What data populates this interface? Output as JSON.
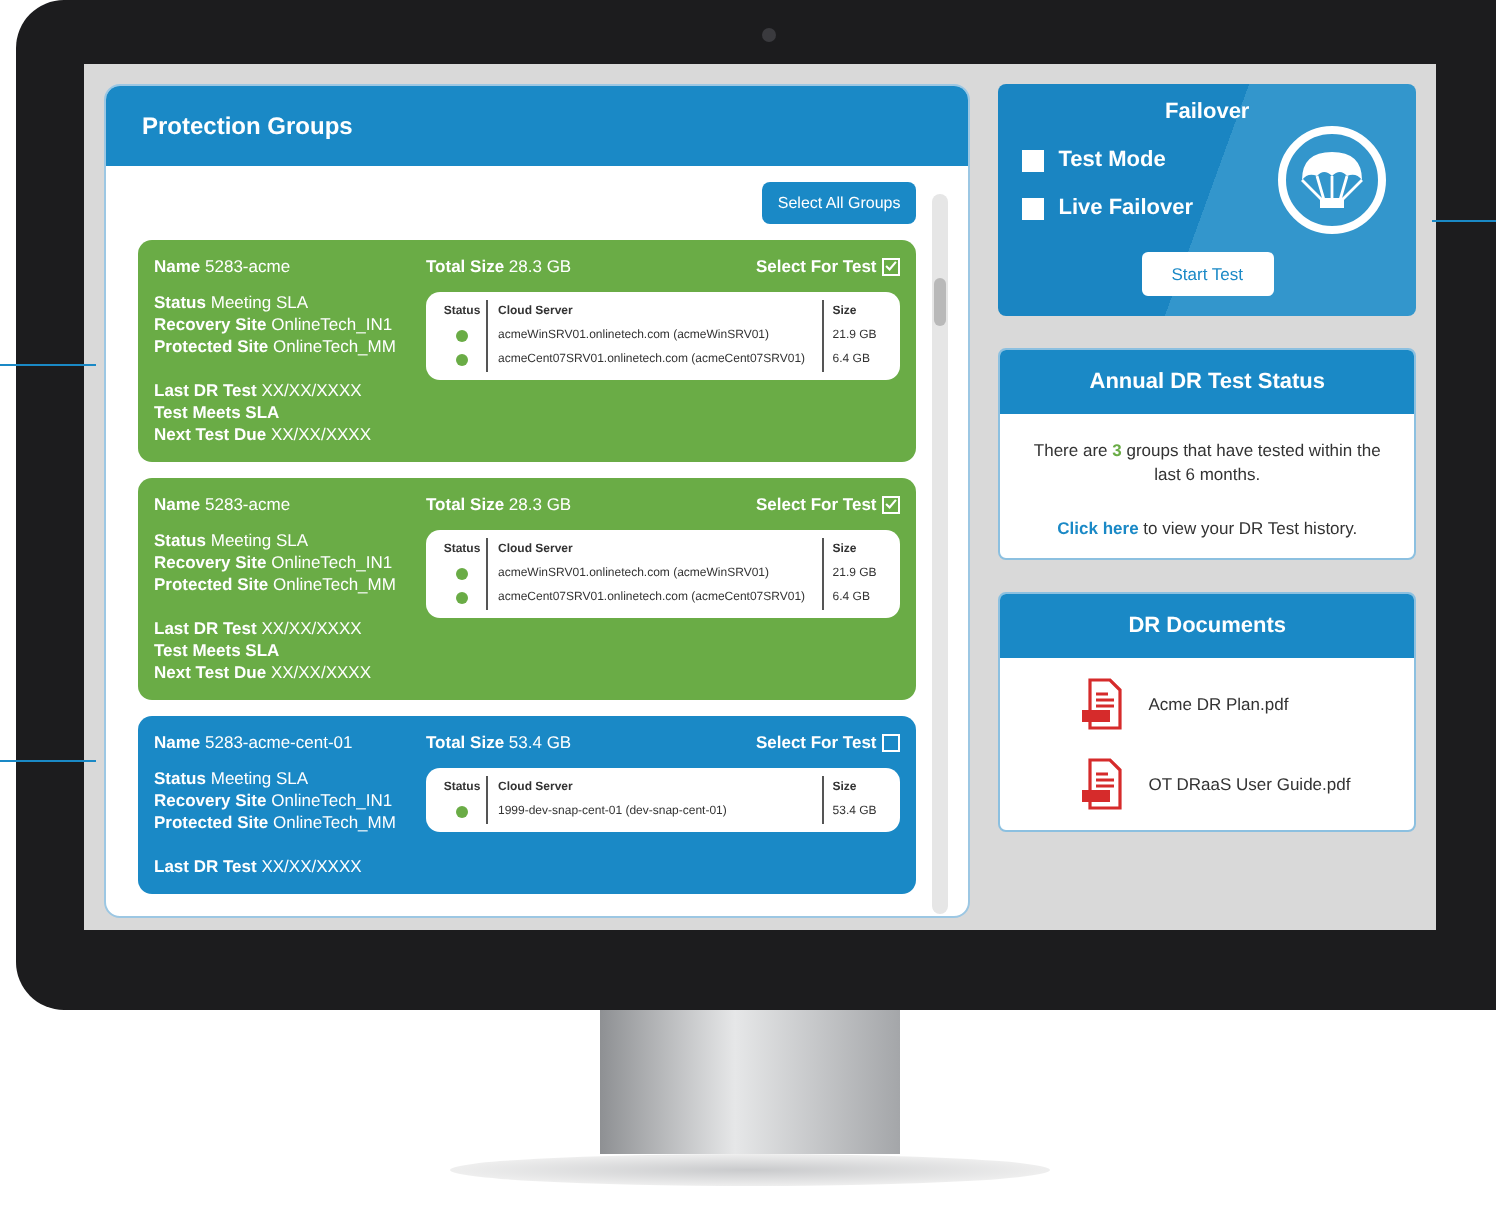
{
  "protection_groups": {
    "title": "Protection Groups",
    "select_all_button": "Select All Groups",
    "groups": [
      {
        "color": "#6aac46",
        "name_label": "Name",
        "name": "5283-acme",
        "size_label": "Total Size",
        "total_size": "28.3 GB",
        "select_label": "Select For Test",
        "checked": true,
        "site_info": [
          {
            "label": "Status",
            "value": "Meeting SLA"
          },
          {
            "label": "Recovery Site",
            "value": "OnlineTech_IN1"
          },
          {
            "label": "Protected Site",
            "value": "OnlineTech_MM"
          }
        ],
        "test_info": [
          {
            "label": "Last DR Test",
            "value": "XX/XX/XXXX"
          },
          {
            "label": "Test Meets SLA"
          },
          {
            "label": "Next Test Due",
            "value": "XX/XX/XXXX"
          }
        ],
        "columns": [
          "Status",
          "Cloud Server",
          "Size"
        ],
        "servers": [
          {
            "color": "#6aac46",
            "server": "acmeWinSRV01.onlinetech.com (acmeWinSRV01)",
            "size": "21.9 GB"
          },
          {
            "color": "#6aac46",
            "server": "acmeCent07SRV01.onlinetech.com (acmeCent07SRV01)",
            "size": "6.4 GB"
          }
        ]
      },
      {
        "color": "#6aac46",
        "name_label": "Name",
        "name": "5283-acme",
        "size_label": "Total Size",
        "total_size": "28.3 GB",
        "select_label": "Select For Test",
        "checked": true,
        "site_info": [
          {
            "label": "Status",
            "value": "Meeting SLA"
          },
          {
            "label": "Recovery Site",
            "value": "OnlineTech_IN1"
          },
          {
            "label": "Protected Site",
            "value": "OnlineTech_MM"
          }
        ],
        "test_info": [
          {
            "label": "Last DR Test",
            "value": "XX/XX/XXXX"
          },
          {
            "label": "Test Meets SLA"
          },
          {
            "label": "Next Test Due",
            "value": "XX/XX/XXXX"
          }
        ],
        "columns": [
          "Status",
          "Cloud Server",
          "Size"
        ],
        "servers": [
          {
            "color": "#6aac46",
            "server": "acmeWinSRV01.onlinetech.com (acmeWinSRV01)",
            "size": "21.9 GB"
          },
          {
            "color": "#6aac46",
            "server": "acmeCent07SRV01.onlinetech.com (acmeCent07SRV01)",
            "size": "6.4 GB"
          }
        ]
      },
      {
        "color": "#1a89c6",
        "name_label": "Name",
        "name": "5283-acme-cent-01",
        "size_label": "Total Size",
        "total_size": "53.4 GB",
        "select_label": "Select For Test",
        "checked": false,
        "site_info": [
          {
            "label": "Status",
            "value": "Meeting SLA"
          },
          {
            "label": "Recovery Site",
            "value": "OnlineTech_IN1"
          },
          {
            "label": "Protected Site",
            "value": "OnlineTech_MM"
          }
        ],
        "test_info": [
          {
            "label": "Last DR Test",
            "value": "XX/XX/XXXX"
          }
        ],
        "columns": [
          "Status",
          "Cloud Server",
          "Size"
        ],
        "servers": [
          {
            "color": "#6aac46",
            "server": "1999-dev-snap-cent-01 (dev-snap-cent-01)",
            "size": "53.4 GB"
          }
        ]
      }
    ]
  },
  "failover": {
    "title": "Failover",
    "options": [
      {
        "label": "Test Mode",
        "checked": false
      },
      {
        "label": "Live Failover",
        "checked": false
      }
    ],
    "button": "Start Test"
  },
  "annual_status": {
    "title": "Annual DR Test Status",
    "summary": "There are **3** groups that have tested within the last 6 months.",
    "link": "Click here",
    "link_rest": " to view your DR Test history."
  },
  "documents": {
    "title": "DR Documents",
    "files": [
      "Acme DR Plan.pdf",
      "OT DRaaS User Guide.pdf"
    ]
  }
}
